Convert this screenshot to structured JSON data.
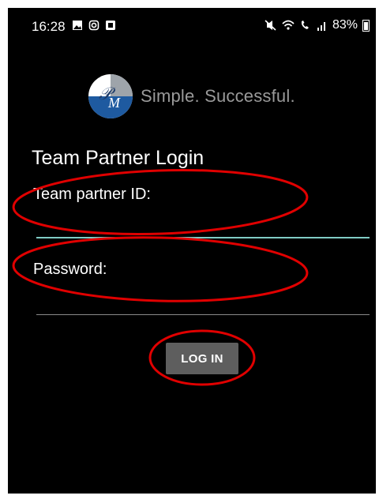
{
  "status_bar": {
    "time": "16:28",
    "battery_percent": "83%",
    "icons_left": [
      "image-notification-icon",
      "instagram-icon",
      "app-notification-icon"
    ],
    "icons_right": [
      "mute-icon",
      "wifi-icon",
      "wifi-calling-icon",
      "signal-icon",
      "battery-icon"
    ]
  },
  "branding": {
    "logo_text": "PM",
    "tagline": "Simple. Successful."
  },
  "form": {
    "title": "Team Partner Login",
    "id_label": "Team partner ID:",
    "id_value": "",
    "password_label": "Password:",
    "password_value": "",
    "login_label": "LOG IN"
  },
  "colors": {
    "background": "#000000",
    "active_underline": "#80cbc4",
    "inactive_underline": "#8a8a8a",
    "button": "#5e5e5e",
    "annotation": "#e00000",
    "logo_blue": "#1e5aa0"
  }
}
